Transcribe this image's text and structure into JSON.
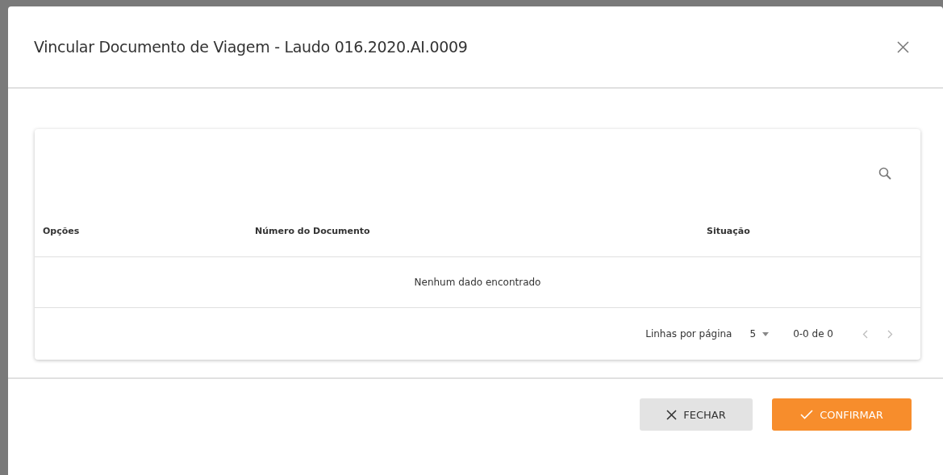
{
  "dialog": {
    "title": "Vincular Documento de Viagem - Laudo 016.2020.AI.0009"
  },
  "table": {
    "columns": [
      "Opções",
      "Número do Documento",
      "Situação"
    ],
    "empty_message": "Nenhum dado encontrado",
    "pagination": {
      "rows_per_page_label": "Linhas por página",
      "rows_per_page": "5",
      "range": "0-0 de 0",
      "prev_disabled": true,
      "next_disabled": true
    }
  },
  "buttons": [
    {
      "label": "FECHAR",
      "kind": "close"
    },
    {
      "label": "CONFIRMAR",
      "kind": "confirm"
    }
  ]
}
